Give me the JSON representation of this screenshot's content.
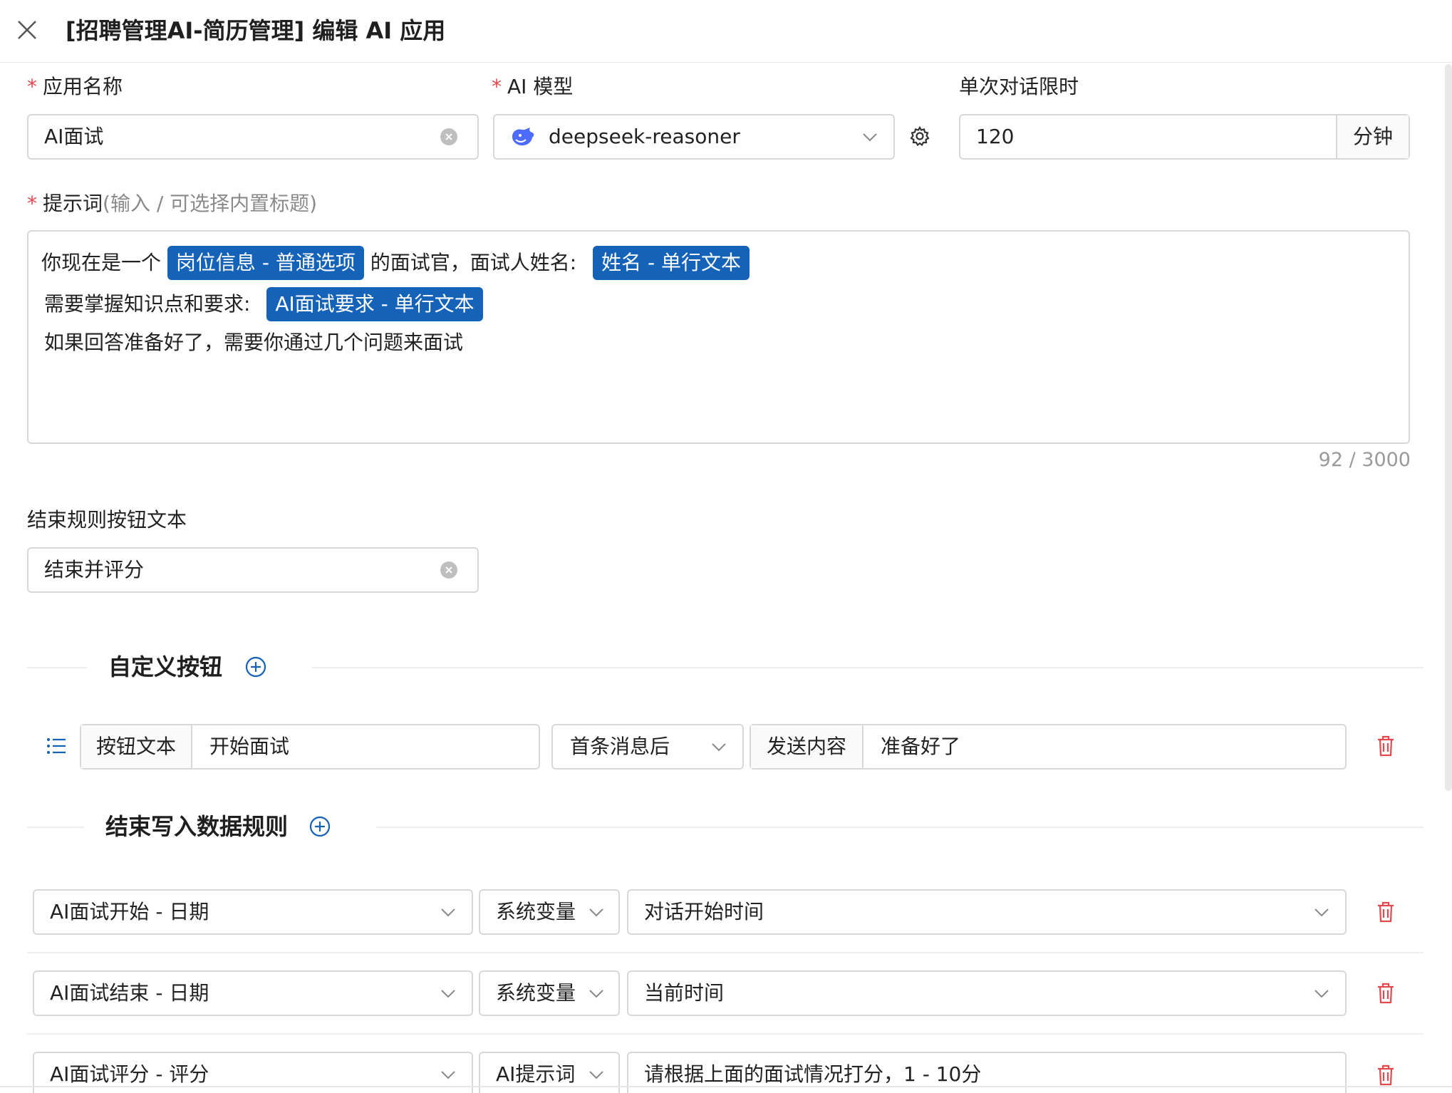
{
  "header": {
    "title": "[招聘管理AI-简历管理] 编辑 AI 应用"
  },
  "form": {
    "app_name": {
      "required": "*",
      "label": "应用名称",
      "value": "AI面试"
    },
    "model": {
      "required": "*",
      "label": "AI 模型",
      "value": "deepseek-reasoner"
    },
    "time_limit": {
      "label": "单次对话限时",
      "value": "120",
      "unit": "分钟"
    },
    "prompt": {
      "required": "*",
      "label": "提示词",
      "hint": "(输入 / 可选择内置标题)",
      "line1_a": "你现在是一个",
      "tag1": "岗位信息 - 普通选项",
      "line1_b": "的面试官，面试人姓名:",
      "tag2": "姓名 - 单行文本",
      "line2_a": "需要掌握知识点和要求:",
      "tag3": "AI面试要求 - 单行文本",
      "line3": "如果回答准备好了，需要你通过几个问题来面试",
      "counter": "92 / 3000"
    },
    "end_button": {
      "label": "结束规则按钮文本",
      "value": "结束并评分"
    }
  },
  "custom_buttons": {
    "title": "自定义按钮",
    "rows": [
      {
        "text_label": "按钮文本",
        "text_value": "开始面试",
        "timing": "首条消息后",
        "send_label": "发送内容",
        "send_value": "准备好了"
      }
    ]
  },
  "end_rules": {
    "title": "结束写入数据规则",
    "rows": [
      {
        "field": "AI面试开始 - 日期",
        "source": "系统变量",
        "value": "对话开始时间"
      },
      {
        "field": "AI面试结束 - 日期",
        "source": "系统变量",
        "value": "当前时间"
      },
      {
        "field": "AI面试评分 - 评分",
        "source": "AI提示词",
        "value": "请根据上面的面试情况打分，1 - 10分"
      }
    ]
  },
  "colors": {
    "accent": "#1463b8",
    "required": "#e5484d",
    "danger": "#e5484d"
  }
}
